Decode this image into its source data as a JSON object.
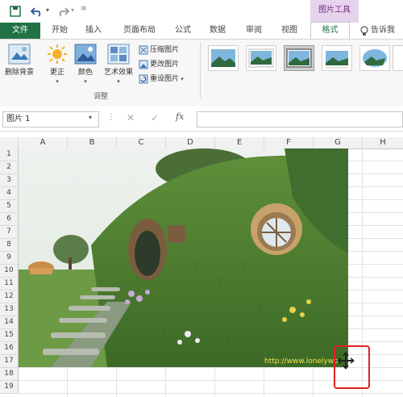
{
  "tabs": [
    "开始",
    "插入",
    "页面布局",
    "公式",
    "数据",
    "审阅",
    "视图"
  ],
  "file_tab": "文件",
  "context_tab_group": "图片工具",
  "format_tab": "格式",
  "tell_me": "告诉我",
  "ribbon": {
    "remove_background": "删除背景",
    "corrections": "更正",
    "color": "颜色",
    "artistic_effects": "艺术效果",
    "compress": "压缩图片",
    "change": "更改图片",
    "reset": "重设图片",
    "group_adjust": "调整"
  },
  "name_box": "图片 1",
  "columns": [
    "A",
    "B",
    "C",
    "D",
    "E",
    "F",
    "G",
    "H"
  ],
  "rows": [
    "1",
    "2",
    "3",
    "4",
    "5",
    "6",
    "7",
    "8",
    "9",
    "10",
    "11",
    "12",
    "13",
    "14",
    "15",
    "16",
    "17",
    "18",
    "19"
  ],
  "watermark": "http://www.lonelywo"
}
